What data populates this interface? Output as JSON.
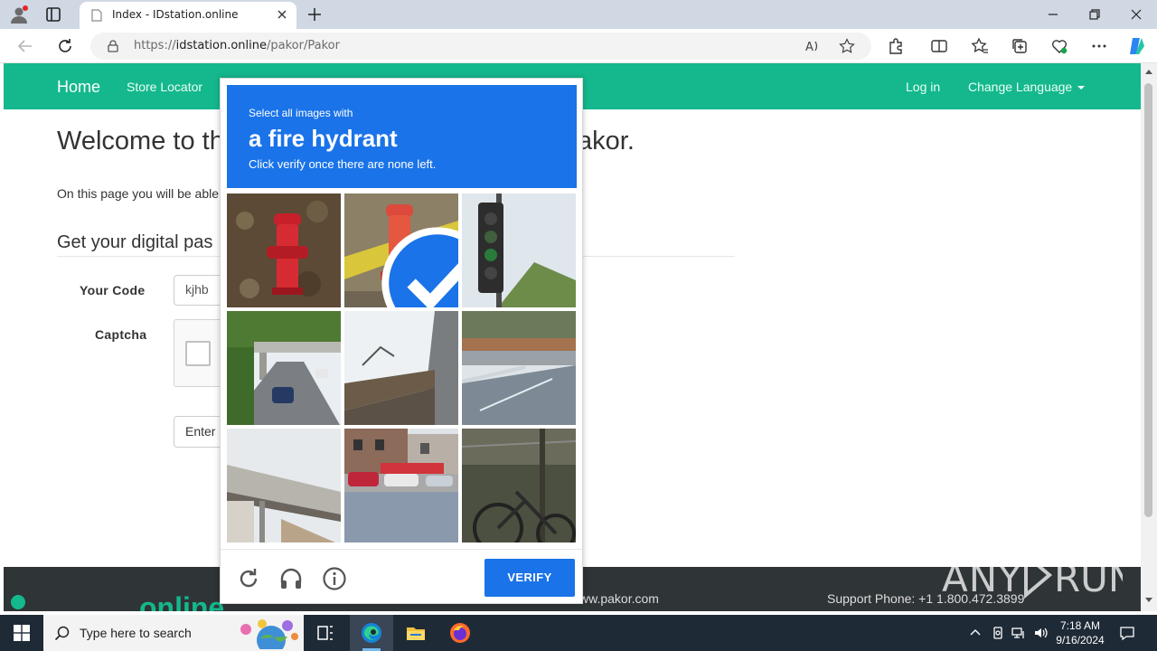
{
  "browser": {
    "tab_title": "Index - IDstation.online",
    "url_prefix": "https://",
    "url_host": "idstation.online",
    "url_path": "/pakor/Pakor"
  },
  "nav": {
    "brand": "Home",
    "store_locator": "Store Locator",
    "login": "Log in",
    "language": "Change Language"
  },
  "page": {
    "welcome_start": "Welcome to th",
    "welcome_end": "akor.",
    "intro": "On this page you will be able",
    "subheading": "Get your digital pas",
    "code_label": "Your Code",
    "code_value": "kjhb",
    "captcha_label": "Captcha",
    "enter_button": "Enter"
  },
  "footer": {
    "logo_text": "online",
    "website": "ww.pakor.com",
    "phone": "Support Phone: +1 1.800.472.3899"
  },
  "watermark": "ANY RUN",
  "challenge": {
    "instruction_pre": "Select all images with",
    "target": "a fire hydrant",
    "instruction_post": "Click verify once there are none left.",
    "verify_button": "VERIFY",
    "tiles": [
      {
        "content": "fire hydrant on leaves",
        "selected": false
      },
      {
        "content": "fire hydrant with checkmark",
        "selected": true
      },
      {
        "content": "traffic light",
        "selected": false
      },
      {
        "content": "highway overpass with car",
        "selected": false
      },
      {
        "content": "bridge under sky",
        "selected": false
      },
      {
        "content": "road with bridge",
        "selected": false
      },
      {
        "content": "bridge with fence",
        "selected": false
      },
      {
        "content": "street with parked cars",
        "selected": false
      },
      {
        "content": "bicycle near fence",
        "selected": false
      }
    ]
  },
  "taskbar": {
    "search_placeholder": "Type here to search",
    "time": "7:18 AM",
    "date": "9/16/2024"
  },
  "colors": {
    "accent_green": "#14b88c",
    "challenge_blue": "#1a73e8",
    "footer_dark": "#2f3437",
    "taskbar": "#1f2a37"
  }
}
